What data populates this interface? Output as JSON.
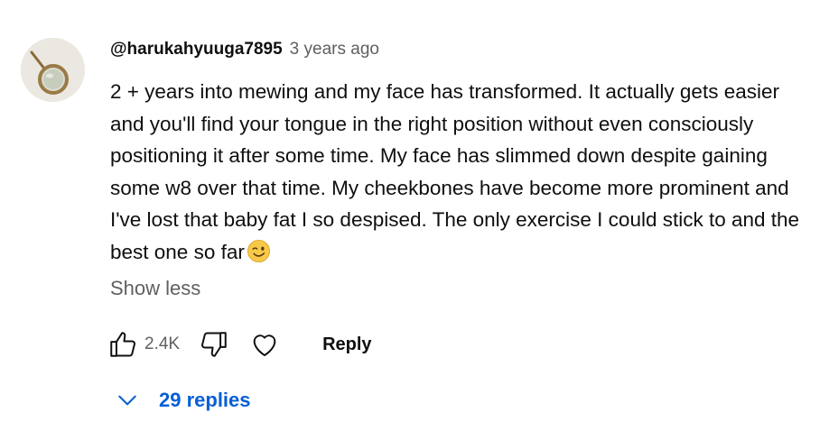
{
  "comment": {
    "author": "@harukahyuuga7895",
    "timestamp": "3 years ago",
    "text": "2 + years into mewing and my face has transformed. It actually gets easier and you'll find your tongue in the right position without even consciously positioning it after some time. My face has slimmed down despite gaining some w8 over that time. My cheekbones have become more prominent and I've lost that baby fat I so despised. The only exercise I could stick to and the best one so far",
    "emoji": "winking-face",
    "show_less_label": "Show less"
  },
  "actions": {
    "like_count": "2.4K",
    "reply_label": "Reply"
  },
  "replies": {
    "label": "29 replies"
  },
  "colors": {
    "link_blue": "#065fd4",
    "secondary_text": "#606060",
    "primary_text": "#0f0f0f"
  }
}
